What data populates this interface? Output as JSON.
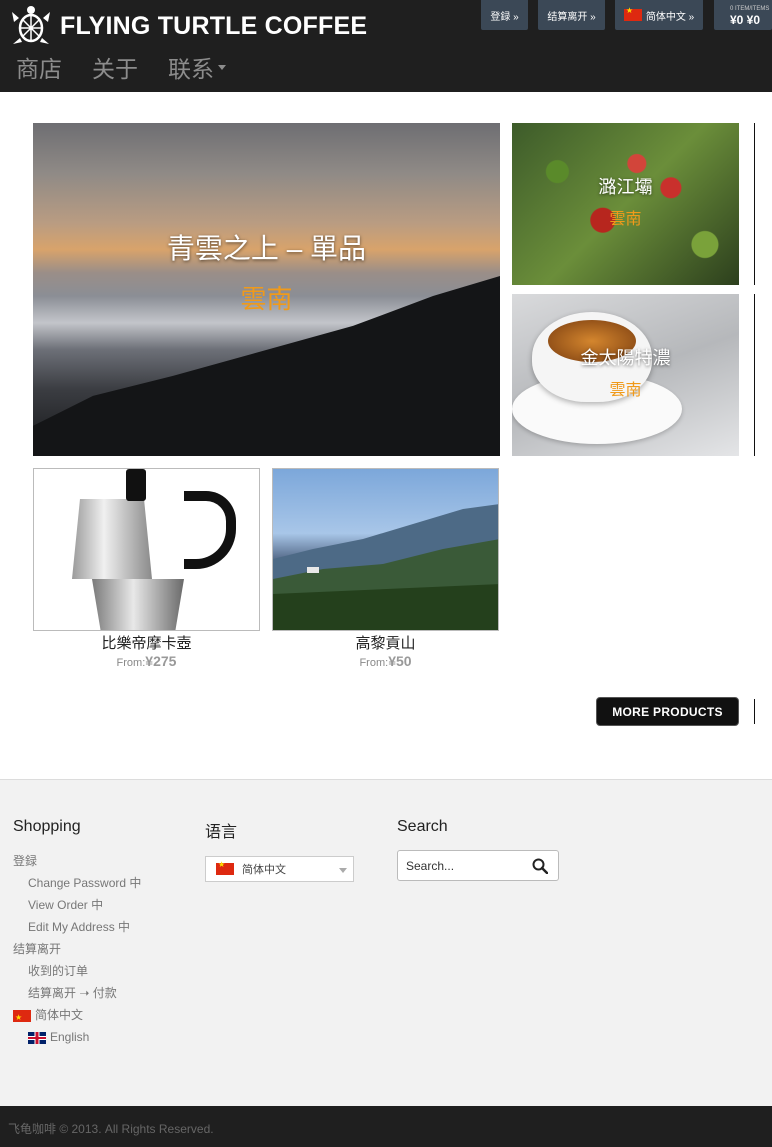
{
  "header": {
    "brand": "FLYING TURTLE COFFEE",
    "nav": [
      {
        "label": "商店"
      },
      {
        "label": "关于"
      },
      {
        "label": "联系",
        "has_dropdown": true
      }
    ],
    "top_buttons": {
      "login": "登録 »",
      "checkout": "结算离开 »",
      "language": "简体中文 »",
      "cart_items": "0 ITEM/ITEMS",
      "cart_total": "¥0 ¥0"
    }
  },
  "hero": {
    "main": {
      "title": "青雲之上 – 單品",
      "region": "雲南"
    },
    "tile1": {
      "title": "潞江壩",
      "region": "雲南"
    },
    "tile2": {
      "title": "金太陽特濃",
      "region": "雲南"
    }
  },
  "products": [
    {
      "name": "比樂帝摩卡壺",
      "from": "From:",
      "price": "¥275"
    },
    {
      "name": "高黎貢山",
      "from": "From:",
      "price": "¥50"
    }
  ],
  "more_button": "MORE PRODUCTS",
  "footer": {
    "shopping": {
      "heading": "Shopping",
      "login": "登録",
      "change_password": "Change Password 中",
      "view_order": "View Order 中",
      "edit_address": "Edit My Address 中",
      "checkout": "结算离开",
      "received_orders": "收到的订单",
      "checkout_pay": "结算离开 ➝ 付款",
      "lang_cn": "简体中文",
      "lang_en": "English"
    },
    "language": {
      "heading": "语言",
      "selected": "简体中文"
    },
    "search": {
      "heading": "Search",
      "placeholder": "Search..."
    },
    "copyright": "飞龟咖啡 © 2013. All Rights Reserved."
  },
  "colors": {
    "header_bg": "#1f1f1f",
    "button_bg": "#3b4856",
    "region_accent": "#f09a1a"
  }
}
